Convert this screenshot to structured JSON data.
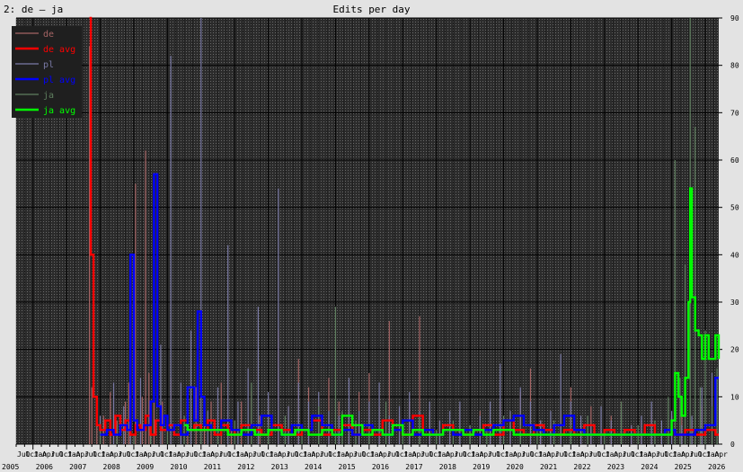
{
  "header": {
    "left_title": "2: de – ja",
    "title": "Edits per day"
  },
  "colors": {
    "background": "#e3e3e3",
    "plot_bg": "#2b2b2b",
    "grid": "#000000",
    "de": "#a56464",
    "de_avg": "#ff0000",
    "pl": "#7a7aa6",
    "pl_avg": "#0000ff",
    "ja": "#5f7f5f",
    "ja_avg": "#00ff00"
  },
  "chart_data": {
    "type": "line",
    "title": "Edits per day",
    "xlabel": "",
    "ylabel": "",
    "ylim": [
      0,
      90
    ],
    "xlim": [
      2005.5,
      2026.4
    ],
    "y_ticks": [
      0,
      10,
      20,
      30,
      40,
      50,
      60,
      70,
      80,
      90
    ],
    "year_labels": [
      "2005",
      "2006",
      "2007",
      "2008",
      "2009",
      "2010",
      "2011",
      "2012",
      "2013",
      "2014",
      "2015",
      "2016",
      "2017",
      "2018",
      "2019",
      "2020",
      "2021",
      "2022",
      "2023",
      "2024",
      "2025",
      "2026"
    ],
    "month_labels": [
      "Jul",
      "Oct",
      "Jan",
      "Apr"
    ],
    "legend": [
      "de",
      "de avg",
      "pl",
      "pl avg",
      "ja",
      "ja avg"
    ],
    "legend_position": "top-left",
    "grid": true,
    "series": [
      {
        "name": "de",
        "style": "thin",
        "x": [
          2007.68,
          2007.75,
          2007.9,
          2008.1,
          2008.3,
          2008.5,
          2008.75,
          2008.85,
          2009.05,
          2009.25,
          2009.35,
          2009.45,
          2009.6,
          2009.85,
          2010.1,
          2010.4,
          2010.6,
          2010.85,
          2011.1,
          2011.3,
          2011.6,
          2011.9,
          2012.2,
          2012.5,
          2012.75,
          2013.0,
          2013.3,
          2013.6,
          2013.9,
          2014.2,
          2014.5,
          2014.8,
          2015.1,
          2015.4,
          2015.7,
          2016.0,
          2016.3,
          2016.6,
          2016.9,
          2017.2,
          2017.5,
          2017.8,
          2018.1,
          2018.4,
          2018.7,
          2019.0,
          2019.3,
          2019.6,
          2019.9,
          2020.2,
          2020.5,
          2020.8,
          2021.1,
          2021.4,
          2021.7,
          2022.0,
          2022.3,
          2022.6,
          2022.9,
          2023.2,
          2023.5,
          2023.8,
          2024.1,
          2024.4,
          2024.7,
          2025.0,
          2025.3,
          2025.6,
          2025.9,
          2026.2
        ],
        "values": [
          84,
          12,
          8,
          6,
          11,
          5,
          9,
          13,
          55,
          10,
          62,
          15,
          41,
          9,
          14,
          7,
          10,
          12,
          6,
          9,
          13,
          5,
          9,
          11,
          6,
          10,
          24,
          8,
          18,
          12,
          5,
          14,
          9,
          7,
          11,
          15,
          8,
          26,
          6,
          9,
          27,
          7,
          5,
          4,
          8,
          3,
          7,
          5,
          9,
          4,
          11,
          16,
          5,
          4,
          7,
          12,
          4,
          8,
          3,
          6,
          9,
          4,
          5,
          7,
          3,
          6,
          9,
          5,
          8,
          4
        ]
      },
      {
        "name": "de avg",
        "style": "avg",
        "x": [
          2007.68,
          2007.72,
          2007.8,
          2007.9,
          2008.0,
          2008.15,
          2008.3,
          2008.45,
          2008.6,
          2008.75,
          2008.9,
          2009.05,
          2009.2,
          2009.35,
          2009.5,
          2009.65,
          2009.8,
          2010.0,
          2010.2,
          2010.4,
          2010.6,
          2010.8,
          2011.0,
          2011.2,
          2011.4,
          2011.6,
          2011.8,
          2012.0,
          2012.2,
          2012.5,
          2012.8,
          2013.1,
          2013.4,
          2013.7,
          2014.0,
          2014.3,
          2014.6,
          2014.9,
          2015.2,
          2015.5,
          2015.8,
          2016.1,
          2016.4,
          2016.7,
          2017.0,
          2017.3,
          2017.6,
          2017.9,
          2018.2,
          2018.5,
          2018.8,
          2019.1,
          2019.4,
          2019.7,
          2020.0,
          2020.3,
          2020.6,
          2020.9,
          2021.2,
          2021.5,
          2021.8,
          2022.1,
          2022.4,
          2022.7,
          2023.0,
          2023.3,
          2023.6,
          2023.9,
          2024.2,
          2024.5,
          2024.8,
          2025.1,
          2025.4,
          2025.7,
          2026.0,
          2026.3
        ],
        "values": [
          90,
          40,
          10,
          4,
          3,
          5,
          2,
          6,
          3,
          5,
          2,
          4,
          3,
          6,
          2,
          5,
          3,
          4,
          2,
          5,
          3,
          4,
          3,
          5,
          2,
          4,
          3,
          2,
          4,
          3,
          2,
          4,
          3,
          2,
          3,
          5,
          2,
          3,
          4,
          2,
          3,
          2,
          5,
          3,
          2,
          6,
          3,
          2,
          4,
          3,
          2,
          3,
          4,
          2,
          5,
          3,
          2,
          4,
          3,
          2,
          3,
          2,
          4,
          2,
          3,
          2,
          3,
          2,
          4,
          2,
          3,
          2,
          3,
          2,
          3,
          2
        ]
      },
      {
        "name": "pl",
        "style": "thin",
        "x": [
          2008.0,
          2008.4,
          2008.7,
          2008.9,
          2009.2,
          2009.5,
          2009.8,
          2010.1,
          2010.4,
          2010.7,
          2011.0,
          2011.2,
          2011.5,
          2011.8,
          2012.1,
          2012.4,
          2012.7,
          2013.0,
          2013.3,
          2013.6,
          2013.9,
          2014.2,
          2014.5,
          2014.8,
          2015.1,
          2015.4,
          2015.7,
          2016.0,
          2016.3,
          2016.6,
          2016.9,
          2017.2,
          2017.5,
          2017.8,
          2018.1,
          2018.4,
          2018.7,
          2019.0,
          2019.3,
          2019.6,
          2019.9,
          2020.2,
          2020.5,
          2020.8,
          2021.1,
          2021.4,
          2021.7,
          2022.0,
          2022.3,
          2022.6,
          2022.9,
          2023.2,
          2023.5,
          2023.8,
          2024.1,
          2024.4,
          2024.7,
          2025.0,
          2025.3,
          2025.6,
          2025.9,
          2026.2
        ],
        "values": [
          6,
          13,
          8,
          40,
          14,
          9,
          21,
          82,
          13,
          24,
          93,
          7,
          12,
          42,
          9,
          16,
          29,
          11,
          54,
          8,
          13,
          9,
          11,
          7,
          6,
          14,
          7,
          9,
          13,
          6,
          8,
          11,
          7,
          9,
          5,
          7,
          9,
          4,
          6,
          9,
          17,
          7,
          12,
          9,
          5,
          7,
          19,
          9,
          6,
          4,
          8,
          5,
          7,
          4,
          6,
          9,
          5,
          7,
          4,
          6,
          12,
          15
        ]
      },
      {
        "name": "pl avg",
        "style": "avg",
        "x": [
          2008.0,
          2008.2,
          2008.4,
          2008.6,
          2008.8,
          2008.9,
          2009.0,
          2009.1,
          2009.3,
          2009.5,
          2009.6,
          2009.7,
          2009.8,
          2009.9,
          2010.0,
          2010.2,
          2010.4,
          2010.6,
          2010.8,
          2010.9,
          2011.0,
          2011.1,
          2011.3,
          2011.6,
          2011.9,
          2012.2,
          2012.5,
          2012.8,
          2013.1,
          2013.4,
          2013.7,
          2014.0,
          2014.3,
          2014.6,
          2014.9,
          2015.2,
          2015.5,
          2015.8,
          2016.1,
          2016.4,
          2016.7,
          2017.0,
          2017.3,
          2017.6,
          2017.9,
          2018.2,
          2018.5,
          2018.8,
          2019.1,
          2019.4,
          2019.7,
          2020.0,
          2020.3,
          2020.6,
          2020.9,
          2021.2,
          2021.5,
          2021.8,
          2022.1,
          2022.4,
          2022.7,
          2023.0,
          2023.3,
          2023.6,
          2023.9,
          2024.2,
          2024.5,
          2024.8,
          2025.1,
          2025.4,
          2025.7,
          2026.0,
          2026.3
        ],
        "values": [
          2,
          3,
          2,
          4,
          3,
          40,
          5,
          3,
          4,
          9,
          57,
          8,
          4,
          6,
          3,
          4,
          2,
          12,
          5,
          28,
          10,
          4,
          3,
          5,
          3,
          2,
          4,
          6,
          3,
          2,
          4,
          3,
          6,
          4,
          2,
          3,
          2,
          4,
          3,
          2,
          3,
          5,
          2,
          3,
          2,
          3,
          2,
          3,
          2,
          3,
          4,
          5,
          6,
          4,
          3,
          2,
          4,
          6,
          3,
          2,
          2,
          2,
          2,
          2,
          2,
          2,
          2,
          3,
          2,
          2,
          3,
          4,
          14
        ]
      },
      {
        "name": "ja",
        "style": "thin",
        "x": [
          2008.0,
          2008.5,
          2009.0,
          2009.5,
          2010.0,
          2010.5,
          2011.0,
          2011.5,
          2012.0,
          2012.5,
          2013.0,
          2013.5,
          2014.0,
          2014.5,
          2015.0,
          2015.2,
          2015.6,
          2016.0,
          2016.5,
          2017.0,
          2017.5,
          2018.0,
          2018.5,
          2019.0,
          2019.5,
          2020.0,
          2020.5,
          2021.0,
          2021.5,
          2022.0,
          2022.5,
          2023.0,
          2023.5,
          2024.0,
          2024.5,
          2024.9,
          2025.1,
          2025.25,
          2025.4,
          2025.55,
          2025.7,
          2025.85,
          2026.0,
          2026.2,
          2026.35
        ],
        "values": [
          3,
          4,
          2,
          5,
          3,
          6,
          4,
          3,
          5,
          13,
          4,
          6,
          3,
          8,
          29,
          7,
          5,
          3,
          9,
          4,
          6,
          3,
          5,
          4,
          3,
          6,
          4,
          3,
          5,
          4,
          6,
          3,
          9,
          4,
          5,
          10,
          60,
          14,
          38,
          90,
          67,
          12,
          24,
          8,
          16
        ]
      },
      {
        "name": "ja avg",
        "style": "avg",
        "x": [
          2010.5,
          2010.6,
          2011.0,
          2011.4,
          2011.8,
          2012.2,
          2012.6,
          2013.0,
          2013.4,
          2013.8,
          2014.2,
          2014.6,
          2014.9,
          2015.2,
          2015.5,
          2015.8,
          2016.1,
          2016.4,
          2016.7,
          2017.0,
          2017.3,
          2017.6,
          2017.9,
          2018.2,
          2018.5,
          2018.8,
          2019.1,
          2019.4,
          2019.7,
          2020.0,
          2020.3,
          2020.6,
          2020.9,
          2021.2,
          2021.5,
          2021.8,
          2022.1,
          2022.4,
          2022.7,
          2023.0,
          2023.3,
          2023.6,
          2023.9,
          2024.2,
          2024.5,
          2024.8,
          2025.0,
          2025.1,
          2025.2,
          2025.3,
          2025.4,
          2025.5,
          2025.55,
          2025.6,
          2025.7,
          2025.8,
          2025.9,
          2026.0,
          2026.1,
          2026.2,
          2026.3,
          2026.4
        ],
        "values": [
          4,
          3,
          3,
          3,
          2,
          3,
          2,
          3,
          2,
          3,
          2,
          3,
          2,
          6,
          4,
          2,
          3,
          2,
          4,
          2,
          3,
          2,
          2,
          3,
          3,
          2,
          3,
          2,
          3,
          3,
          2,
          2,
          2,
          2,
          2,
          2,
          2,
          2,
          2,
          2,
          2,
          2,
          2,
          2,
          2,
          2,
          5,
          15,
          10,
          6,
          14,
          30,
          54,
          31,
          24,
          23,
          18,
          23,
          18,
          18,
          23,
          18
        ]
      }
    ]
  }
}
